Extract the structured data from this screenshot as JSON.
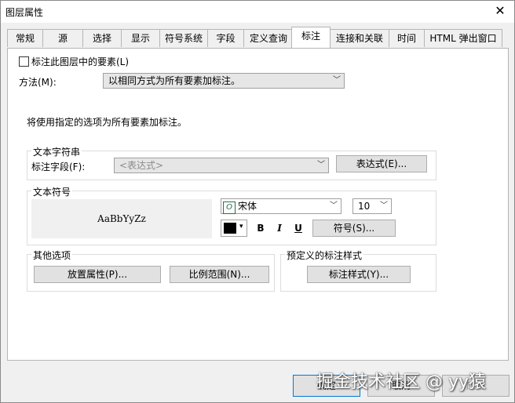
{
  "window": {
    "title": "图层属性",
    "close_glyph": "✕"
  },
  "tabs": [
    {
      "label": "常规"
    },
    {
      "label": "源"
    },
    {
      "label": "选择"
    },
    {
      "label": "显示"
    },
    {
      "label": "符号系统"
    },
    {
      "label": "字段"
    },
    {
      "label": "定义查询"
    },
    {
      "label": "标注"
    },
    {
      "label": "连接和关联"
    },
    {
      "label": "时间"
    },
    {
      "label": "HTML 弹出窗口"
    }
  ],
  "active_tab": "标注",
  "label_panel": {
    "enable_checkbox_label": "标注此图层中的要素(L)",
    "enable_checked": false,
    "method_label": "方法(M):",
    "method_value": "以相同方式为所有要素加标注。",
    "info_text": "将使用指定的选项为所有要素加标注。",
    "text_string": {
      "group_label": "文本字符串",
      "field_label": "标注字段(F):",
      "field_value": "<表达式>",
      "expression_button": "表达式(E)..."
    },
    "text_symbol": {
      "group_label": "文本符号",
      "preview_text": "AaBbYyZz",
      "font_icon": "opentype-font-icon",
      "font_name": "宋体",
      "font_size": "10",
      "color_hex": "#000000",
      "bold": "B",
      "italic": "I",
      "underline": "U",
      "symbol_button": "符号(S)..."
    },
    "other_options": {
      "group_label": "其他选项",
      "placement_button": "放置属性(P)...",
      "scale_button": "比例范围(N)..."
    },
    "predefined_styles": {
      "group_label": "预定义的标注样式",
      "style_button": "标注样式(Y)..."
    }
  },
  "footer": {
    "ok": "确定",
    "cancel": "取消",
    "apply": "应用"
  },
  "watermark": "掘金技术社区 @ yy猿"
}
